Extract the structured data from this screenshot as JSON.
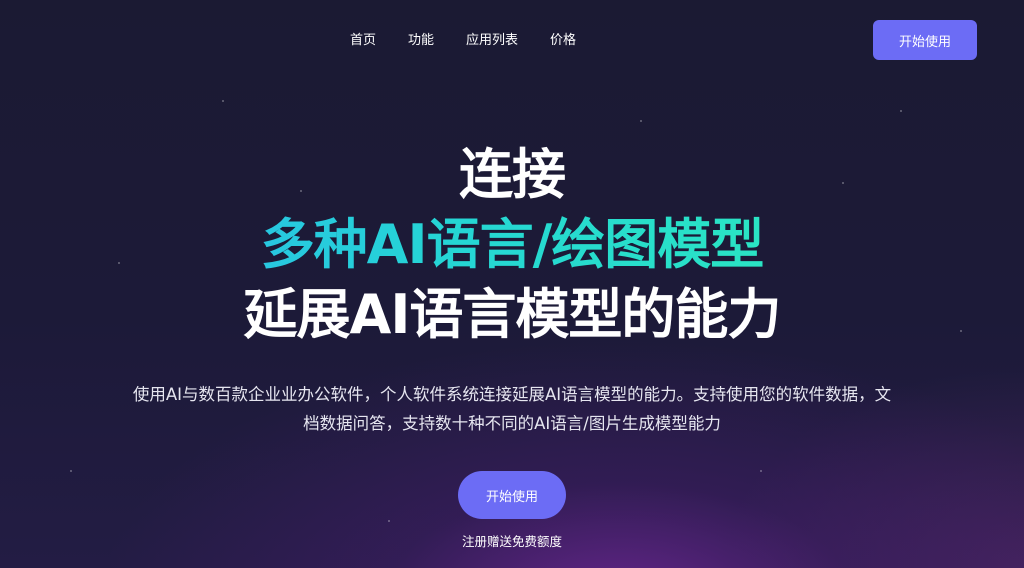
{
  "nav": {
    "items": [
      {
        "label": "首页"
      },
      {
        "label": "功能"
      },
      {
        "label": "应用列表"
      },
      {
        "label": "价格"
      }
    ],
    "cta_label": "开始使用"
  },
  "hero": {
    "line1": "连接",
    "line2": "多种AI语言/绘图模型",
    "line3": "延展AI语言模型的能力",
    "subtitle": "使用AI与数百款企业业办公软件，个人软件系统连接延展AI语言模型的能力。支持使用您的软件数据，文档数据问答，支持数十种不同的AI语言/图片生成模型能力",
    "cta_label": "开始使用",
    "note": "注册赠送免费额度"
  },
  "colors": {
    "accent": "#6c6cf5",
    "gradient_start": "#2bb4f0",
    "gradient_end": "#2ef0b6",
    "background": "#1b1a33"
  }
}
